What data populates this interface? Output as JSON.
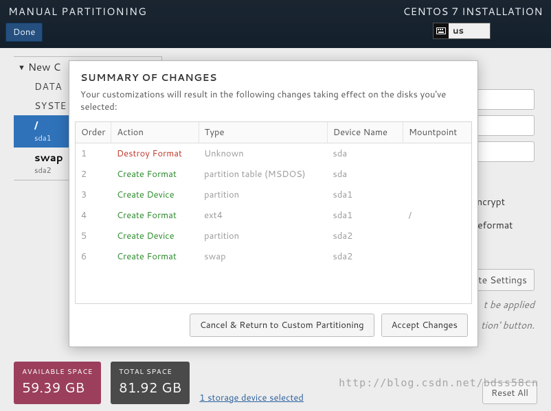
{
  "header": {
    "title_left": "MANUAL PARTITIONING",
    "title_right": "CENTOS 7 INSTALLATION",
    "done": "Done",
    "keyboard_layout": "us"
  },
  "sidebar": {
    "expand_label": "New C",
    "group_data": "DATA",
    "group_system": "SYSTE",
    "items": [
      {
        "mount": "/",
        "device": "sda1"
      },
      {
        "mount": "swap",
        "device": "sda2"
      }
    ],
    "add_label": "+",
    "remove_label": "−"
  },
  "right": {
    "encrypt": "Encrypt",
    "reformat": "Reformat",
    "settings_btn": "te Settings",
    "hint1": "t be applied",
    "hint2": "tion' button."
  },
  "bottom": {
    "avail_label": "AVAILABLE SPACE",
    "avail_value": "59.39 GB",
    "total_label": "TOTAL SPACE",
    "total_value": "81.92 GB",
    "storage_link": "1 storage device selected",
    "reset": "Reset All"
  },
  "watermark": "http://blog.csdn.net/bdss58cn",
  "modal": {
    "title": "SUMMARY OF CHANGES",
    "subtitle": "Your customizations will result in the following changes taking effect on the disks you've selected:",
    "columns": {
      "order": "Order",
      "action": "Action",
      "type": "Type",
      "device": "Device Name",
      "mount": "Mountpoint"
    },
    "rows": [
      {
        "order": "1",
        "action": "Destroy Format",
        "actionKind": "destroy",
        "type": "Unknown",
        "device": "sda",
        "mount": ""
      },
      {
        "order": "2",
        "action": "Create Format",
        "actionKind": "create",
        "type": "partition table (MSDOS)",
        "device": "sda",
        "mount": ""
      },
      {
        "order": "3",
        "action": "Create Device",
        "actionKind": "create",
        "type": "partition",
        "device": "sda1",
        "mount": ""
      },
      {
        "order": "4",
        "action": "Create Format",
        "actionKind": "create",
        "type": "ext4",
        "device": "sda1",
        "mount": "/"
      },
      {
        "order": "5",
        "action": "Create Device",
        "actionKind": "create",
        "type": "partition",
        "device": "sda2",
        "mount": ""
      },
      {
        "order": "6",
        "action": "Create Format",
        "actionKind": "create",
        "type": "swap",
        "device": "sda2",
        "mount": ""
      }
    ],
    "cancel": "Cancel & Return to Custom Partitioning",
    "accept": "Accept Changes"
  }
}
